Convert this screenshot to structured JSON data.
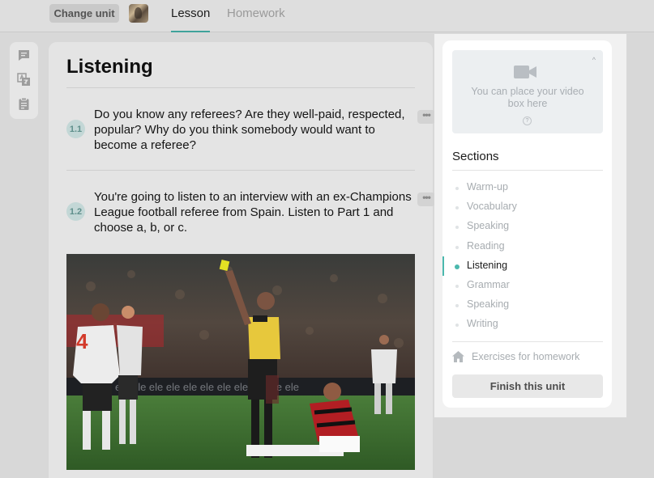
{
  "header": {
    "change_unit_label": "Change unit",
    "tabs": [
      {
        "label": "Lesson",
        "active": true
      },
      {
        "label": "Homework",
        "active": false
      }
    ]
  },
  "tools": {
    "icons": [
      "comment-icon",
      "translate-icon",
      "notes-icon"
    ]
  },
  "main": {
    "section_title": "Listening",
    "tasks": [
      {
        "number": "1.1",
        "text": "Do you know any referees? Are they well-paid, respected, popular? Why do you think somebody would want to become a referee?",
        "menu_label": "•••"
      },
      {
        "number": "1.2",
        "text": "You're going to listen to an interview with an ex-Champions League football referee from Spain. Listen to Part 1 and choose a, b, or c.",
        "menu_label": "•••"
      }
    ],
    "photo_shirt_number": "4"
  },
  "panel": {
    "video_placeholder": "You can place your video box here",
    "video_help": "?",
    "video_collapse": "^",
    "sections_title": "Sections",
    "sections": [
      {
        "label": "Warm-up",
        "active": false
      },
      {
        "label": "Vocabulary",
        "active": false
      },
      {
        "label": "Speaking",
        "active": false
      },
      {
        "label": "Reading",
        "active": false
      },
      {
        "label": "Listening",
        "active": true
      },
      {
        "label": "Grammar",
        "active": false
      },
      {
        "label": "Speaking",
        "active": false
      },
      {
        "label": "Writing",
        "active": false
      }
    ],
    "homework_link": "Exercises for homework",
    "finish_button": "Finish this unit"
  },
  "colors": {
    "accent": "#4bb8ad",
    "page_bg": "#d8d8d8",
    "card_bg": "#e4e4e4",
    "panel_bg": "#ffffff"
  }
}
